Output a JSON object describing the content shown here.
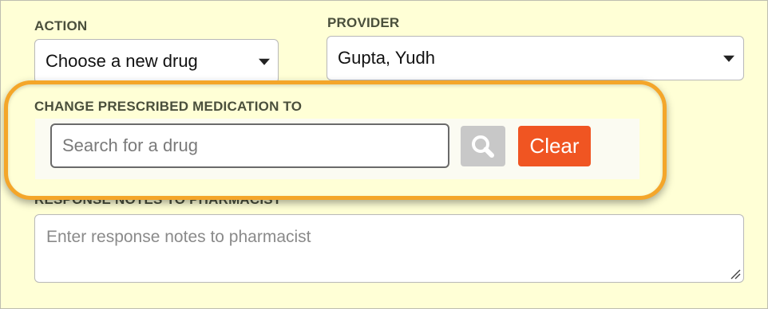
{
  "action": {
    "label": "ACTION",
    "selected": "Choose a new drug"
  },
  "provider": {
    "label": "PROVIDER",
    "selected": "Gupta, Yudh"
  },
  "change_medication": {
    "label": "CHANGE PRESCRIBED MEDICATION TO",
    "search_placeholder": "Search for a drug",
    "search_icon": "magnifier-icon",
    "clear_label": "Clear"
  },
  "notes": {
    "label": "RESPONSE NOTES TO PHARMACIST",
    "placeholder": "Enter response notes to pharmacist"
  },
  "colors": {
    "panel_background": "#ffffd6",
    "highlight_ring": "#f4a62a",
    "clear_button": "#f05522",
    "search_button": "#c8c8c8"
  }
}
